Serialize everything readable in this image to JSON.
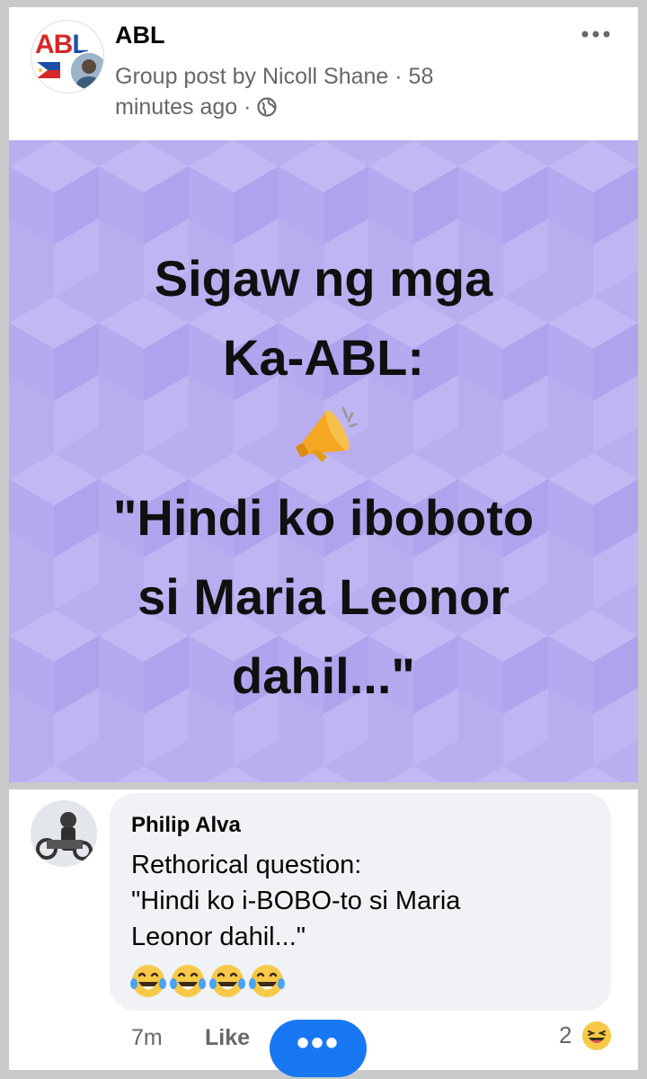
{
  "post": {
    "group_name": "ABL",
    "group_logo_text_red": "AB",
    "group_logo_text_blue": "L",
    "meta_text": "Group post by Nicoll Shane · 58 minutes ago · ",
    "more_icon": "more-horizontal-icon"
  },
  "image": {
    "line1": "Sigaw ng mga",
    "line2": "Ka-ABL:",
    "line3": "\"Hindi ko iboboto",
    "line4": "si Maria Leonor",
    "line5": "dahil...\"",
    "emoji": "megaphone-icon",
    "background_color": "#b9aef0"
  },
  "comment": {
    "author": "Philip Alva",
    "text_line1": "Rethorical question:",
    "text_line2": "\"Hindi ko i-BOBO-to si Maria",
    "text_line3": "Leonor dahil...\"",
    "emoji_count": 4,
    "emoji": "laughing-tears-icon",
    "time": "7m",
    "like_label": "Like",
    "reaction_count": "2",
    "reaction_icon": "haha-reaction-icon"
  },
  "fab": {
    "label": "•••",
    "color": "#1877f2"
  }
}
